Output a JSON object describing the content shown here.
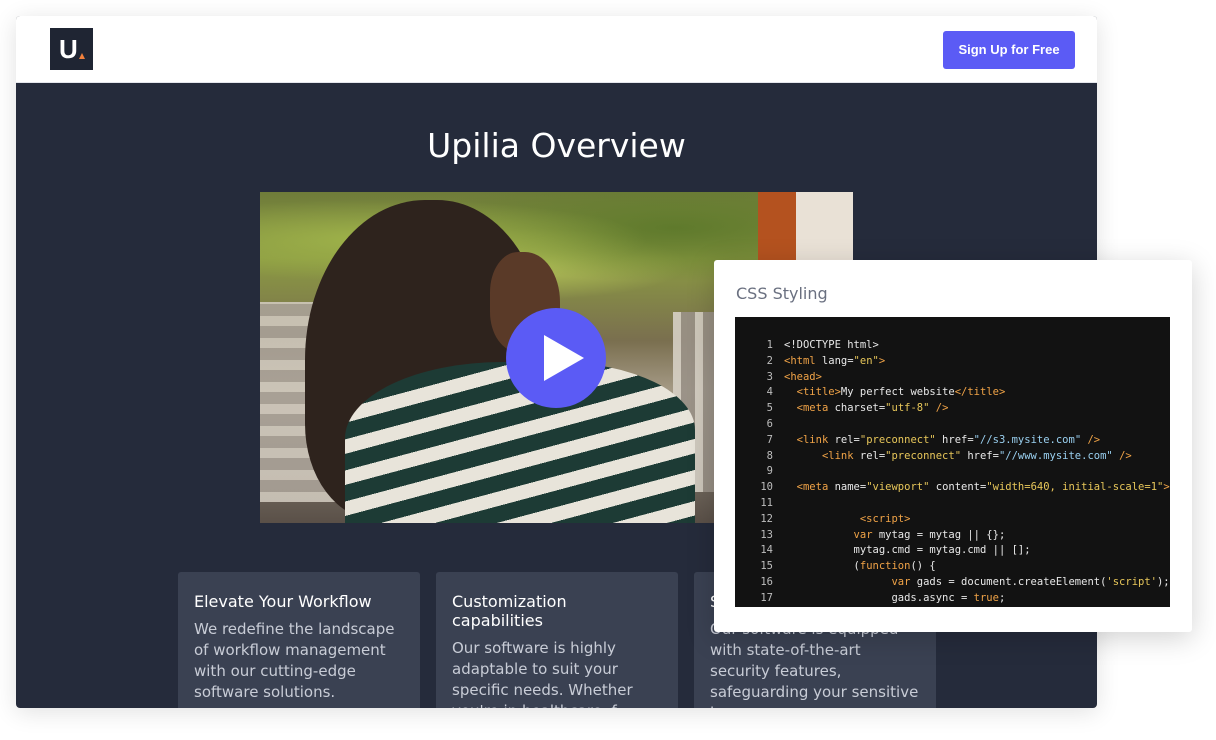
{
  "header": {
    "logo_text": "U",
    "signup_label": "Sign Up for Free"
  },
  "main": {
    "title": "Upilia Overview",
    "video": {
      "play_icon": "play-icon"
    }
  },
  "cards": [
    {
      "title": "Elevate Your Workflow",
      "body": "We redefine the landscape of workflow management with our cutting-edge software solutions."
    },
    {
      "title": "Customization capabilities",
      "body": "Our software is highly adaptable to suit your specific needs. Whether you're in healthcare, f..."
    },
    {
      "title": "S",
      "body": "Our software is equipped with state-of-the-art security features, safeguarding your sensitive i..."
    }
  ],
  "code_panel": {
    "title": "CSS Styling",
    "lines": [
      {
        "n": "1",
        "indent": "",
        "parts": [
          [
            "plain",
            "<!DOCTYPE html>"
          ]
        ]
      },
      {
        "n": "2",
        "indent": "",
        "parts": [
          [
            "tag",
            "<html"
          ],
          [
            "plain",
            " lang="
          ],
          [
            "str",
            "\"en\""
          ],
          [
            "tag",
            ">"
          ]
        ]
      },
      {
        "n": "3",
        "indent": "",
        "parts": [
          [
            "tag",
            "<head>"
          ]
        ]
      },
      {
        "n": "4",
        "indent": "  ",
        "parts": [
          [
            "tag",
            "<title>"
          ],
          [
            "plain",
            "My perfect website"
          ],
          [
            "tag",
            "</title>"
          ]
        ]
      },
      {
        "n": "5",
        "indent": "  ",
        "parts": [
          [
            "tag",
            "<meta"
          ],
          [
            "plain",
            " charset="
          ],
          [
            "str",
            "\"utf-8\""
          ],
          [
            "tag",
            " />"
          ]
        ]
      },
      {
        "n": "6",
        "indent": "",
        "parts": []
      },
      {
        "n": "7",
        "indent": "  ",
        "parts": [
          [
            "tag",
            "<link"
          ],
          [
            "plain",
            " rel="
          ],
          [
            "str",
            "\"preconnect\""
          ],
          [
            "plain",
            " href="
          ],
          [
            "url",
            "\"//s3.mysite.com\""
          ],
          [
            "tag",
            " />"
          ]
        ]
      },
      {
        "n": "8",
        "indent": "      ",
        "parts": [
          [
            "tag",
            "<link"
          ],
          [
            "plain",
            " rel="
          ],
          [
            "str",
            "\"preconnect\""
          ],
          [
            "plain",
            " href="
          ],
          [
            "url",
            "\"//www.mysite.com\""
          ],
          [
            "tag",
            " />"
          ]
        ]
      },
      {
        "n": "9",
        "indent": "",
        "parts": []
      },
      {
        "n": "10",
        "indent": "  ",
        "parts": [
          [
            "tag",
            "<meta"
          ],
          [
            "plain",
            " name="
          ],
          [
            "str",
            "\"viewport\""
          ],
          [
            "plain",
            " content="
          ],
          [
            "str",
            "\"width=640, initial-scale=1\""
          ],
          [
            "tag",
            ">"
          ]
        ]
      },
      {
        "n": "11",
        "indent": "",
        "parts": []
      },
      {
        "n": "12",
        "indent": "            ",
        "parts": [
          [
            "tag",
            "<script>"
          ]
        ]
      },
      {
        "n": "13",
        "indent": "           ",
        "parts": [
          [
            "kw",
            "var"
          ],
          [
            "plain",
            " mytag = mytag || {};"
          ]
        ]
      },
      {
        "n": "14",
        "indent": "           ",
        "parts": [
          [
            "plain",
            "mytag.cmd = mytag.cmd || [];"
          ]
        ]
      },
      {
        "n": "15",
        "indent": "           ",
        "parts": [
          [
            "plain",
            "("
          ],
          [
            "kw",
            "function"
          ],
          [
            "plain",
            "() {"
          ]
        ]
      },
      {
        "n": "16",
        "indent": "                 ",
        "parts": [
          [
            "kw",
            "var"
          ],
          [
            "plain",
            " gads = document.createElement("
          ],
          [
            "str",
            "'script'"
          ],
          [
            "plain",
            ");"
          ]
        ]
      },
      {
        "n": "17",
        "indent": "                 ",
        "parts": [
          [
            "plain",
            "gads.async = "
          ],
          [
            "kw",
            "true"
          ],
          [
            "plain",
            ";"
          ]
        ]
      }
    ]
  }
}
